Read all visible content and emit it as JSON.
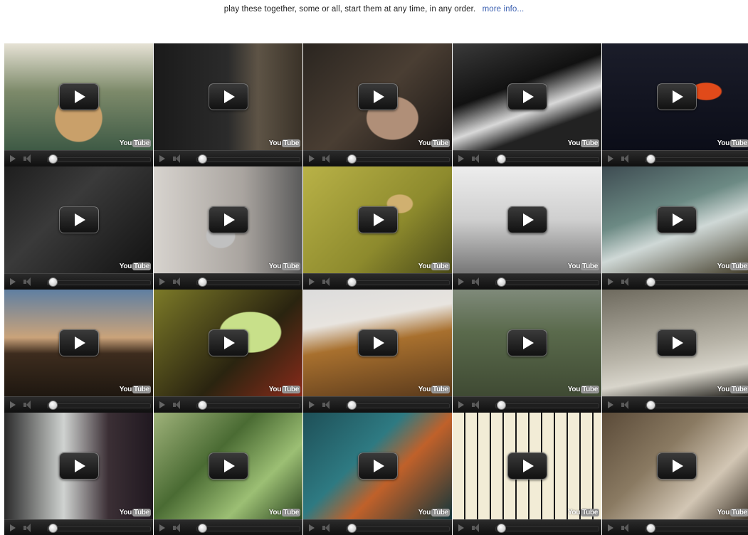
{
  "header": {
    "intro_text": "play these together, some or all, start them at any time, in any order.",
    "more_info_label": "more info..."
  },
  "colors": {
    "link": "#3a5fb0",
    "background": "#ffffff"
  },
  "player_chrome": {
    "logo_you": "You",
    "logo_tube": "Tube"
  },
  "players": [
    {
      "scene": "hands playing glass bottles on a table"
    },
    {
      "scene": "guitar amp and electric guitar"
    },
    {
      "scene": "hand on drum machine controls"
    },
    {
      "scene": "hands on electric piano keys"
    },
    {
      "scene": "person holding toy instrument"
    },
    {
      "scene": "bass guitar player in dark room"
    },
    {
      "scene": "person playing trumpet"
    },
    {
      "scene": "person in yellow hallway"
    },
    {
      "scene": "person at synthesizer keyboard"
    },
    {
      "scene": "hands playing banjo"
    },
    {
      "scene": "sky at sunset"
    },
    {
      "scene": "person holding handheld game console"
    },
    {
      "scene": "acoustic guitar close up"
    },
    {
      "scene": "city view from above"
    },
    {
      "scene": "hands at turntable"
    },
    {
      "scene": "person at keyboard by window"
    },
    {
      "scene": "tree leaves outdoors"
    },
    {
      "scene": "hands on sampler pads"
    },
    {
      "scene": "piano keys close up"
    },
    {
      "scene": "person playing violin"
    }
  ]
}
